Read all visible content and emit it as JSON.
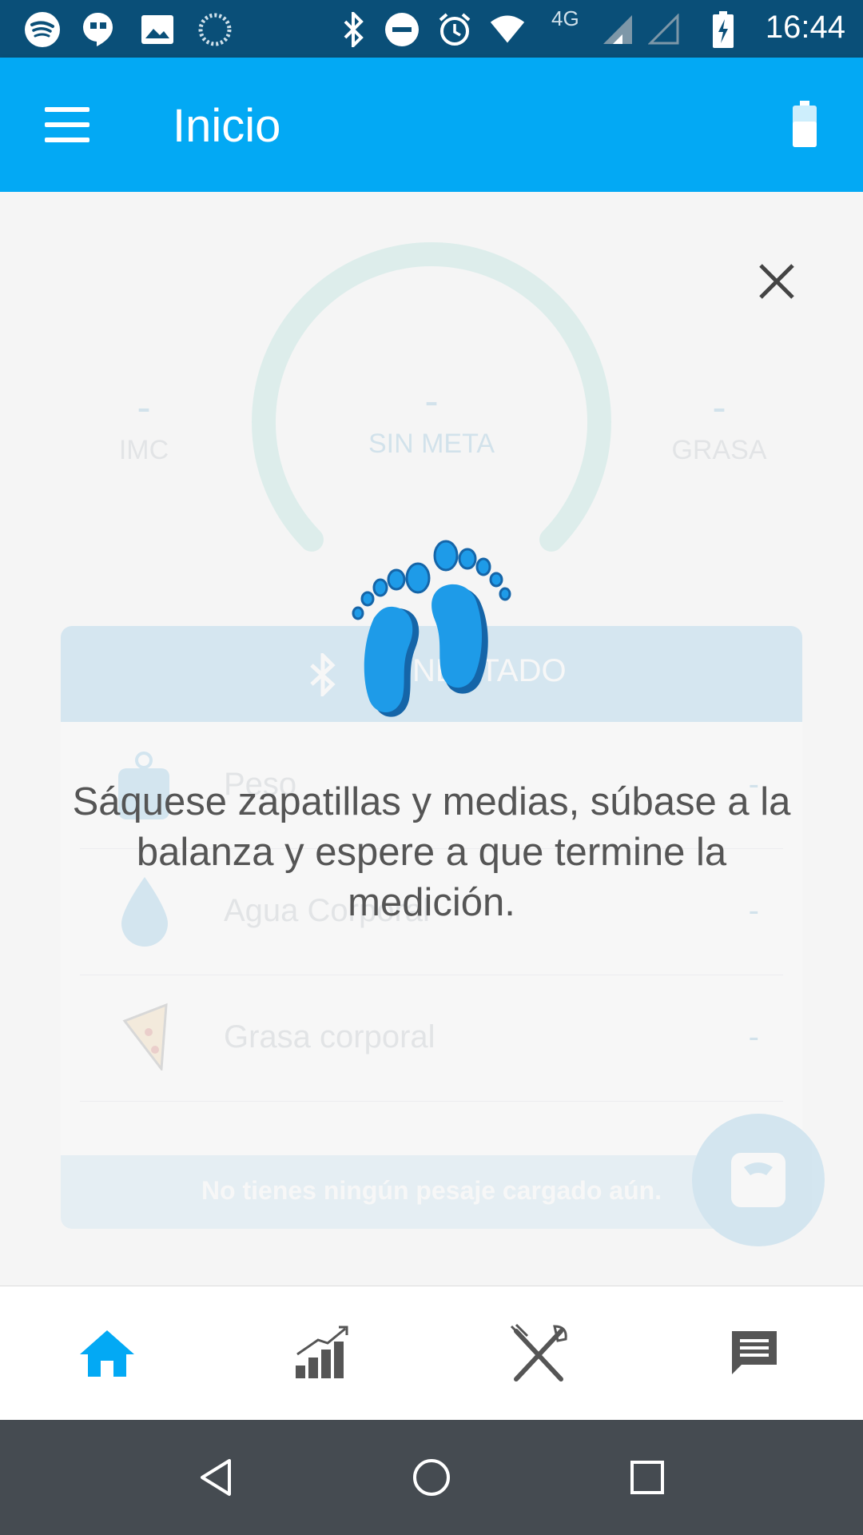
{
  "status_bar": {
    "time": "16:44",
    "network": "4G",
    "icons": [
      "spotify-icon",
      "hangouts-icon",
      "gallery-icon",
      "sync-icon",
      "bluetooth-icon",
      "dnd-icon",
      "alarm-icon",
      "wifi-icon",
      "signal-icon",
      "signal-empty-icon",
      "battery-charging-icon"
    ]
  },
  "app_bar": {
    "title": "Inicio",
    "menu_icon": "menu-icon",
    "action_icon": "scale-battery-icon"
  },
  "background": {
    "gauge_value": "-",
    "gauge_label": "SIN META",
    "left_metric": {
      "value": "-",
      "label": "IMC"
    },
    "right_metric": {
      "value": "-",
      "label": "GRASA"
    },
    "card_header": "NECTADO",
    "rows": [
      {
        "icon": "weight-kg-icon",
        "name": "Peso",
        "value": "-"
      },
      {
        "icon": "water-drop-icon",
        "name": "Agua Corporal",
        "value": "-"
      },
      {
        "icon": "pizza-icon",
        "name": "Grasa corporal",
        "value": "-"
      }
    ],
    "footer_text": "No tienes ningún pesaje cargado aún."
  },
  "overlay": {
    "instruction": "Sáquese zapatillas y medias, súbase a la balanza y espere a que termine la medición.",
    "close_icon": "close-icon",
    "illustration": "bare-feet-icon"
  },
  "bottom_nav": [
    {
      "icon": "home-icon",
      "active": true
    },
    {
      "icon": "stats-chart-icon",
      "active": false
    },
    {
      "icon": "fork-knife-icon",
      "active": false
    },
    {
      "icon": "chat-icon",
      "active": false
    }
  ],
  "colors": {
    "primary": "#03a9f4",
    "status_bar": "#0a4f78",
    "active_nav": "#03a9f4",
    "inactive_nav": "#555555",
    "system_nav": "#454b51"
  }
}
